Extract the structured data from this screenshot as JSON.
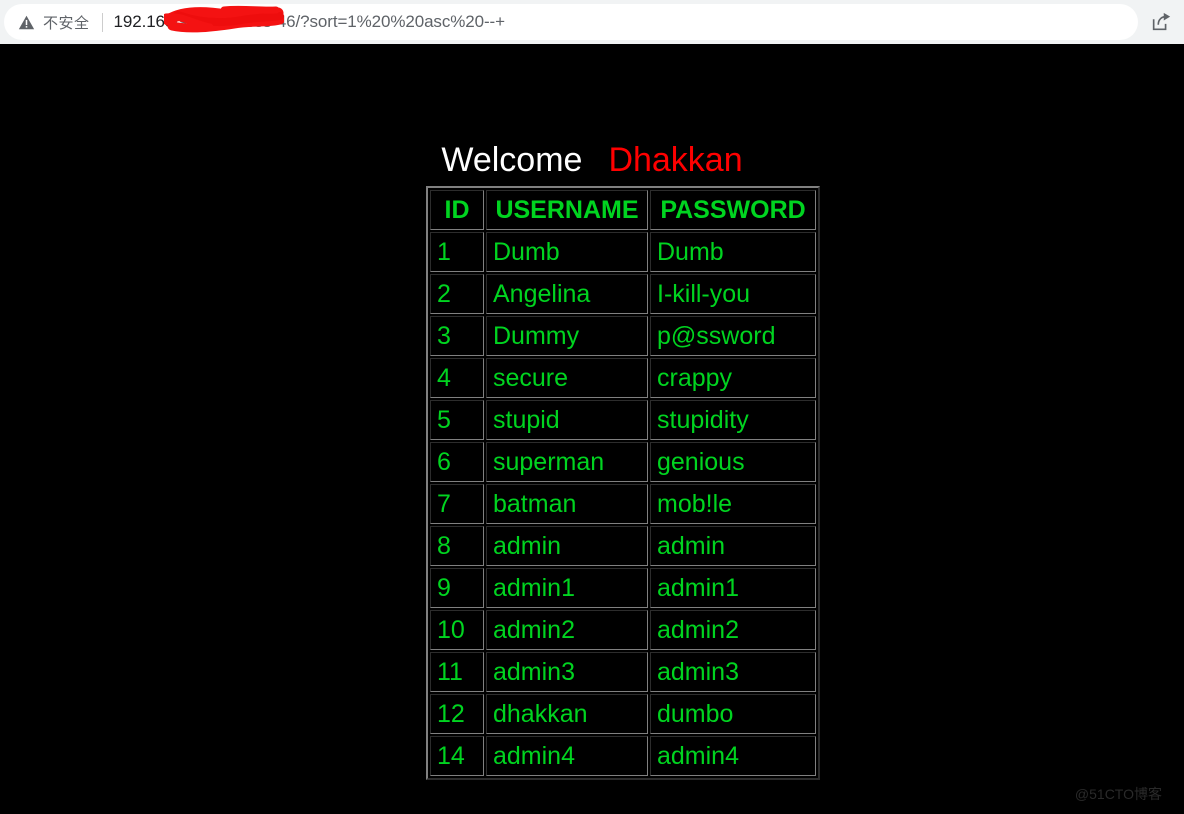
{
  "browser": {
    "security_icon": "warning-triangle-icon",
    "security_label": "不安全",
    "url_host": "192.168",
    "url_path": "/sqllabs/Less-46/?sort=1%20%20asc%20--+",
    "url_full": "192.168.x.x/sqllabs/Less-46/?sort=1%20%20asc%20--+",
    "share_icon": "share-icon",
    "redaction": "red-scribble-over-ip"
  },
  "page": {
    "heading_welcome": "Welcome",
    "heading_name": "Dhakkan",
    "background_color": "#000000",
    "text_color": "#00d420",
    "accent_red": "#ff0000",
    "watermark": "@51CTO博客"
  },
  "table": {
    "columns": [
      "ID",
      "USERNAME",
      "PASSWORD"
    ],
    "rows": [
      [
        "1",
        "Dumb",
        "Dumb"
      ],
      [
        "2",
        "Angelina",
        "I-kill-you"
      ],
      [
        "3",
        "Dummy",
        "p@ssword"
      ],
      [
        "4",
        "secure",
        "crappy"
      ],
      [
        "5",
        "stupid",
        "stupidity"
      ],
      [
        "6",
        "superman",
        "genious"
      ],
      [
        "7",
        "batman",
        "mob!le"
      ],
      [
        "8",
        "admin",
        "admin"
      ],
      [
        "9",
        "admin1",
        "admin1"
      ],
      [
        "10",
        "admin2",
        "admin2"
      ],
      [
        "11",
        "admin3",
        "admin3"
      ],
      [
        "12",
        "dhakkan",
        "dumbo"
      ],
      [
        "14",
        "admin4",
        "admin4"
      ]
    ]
  }
}
